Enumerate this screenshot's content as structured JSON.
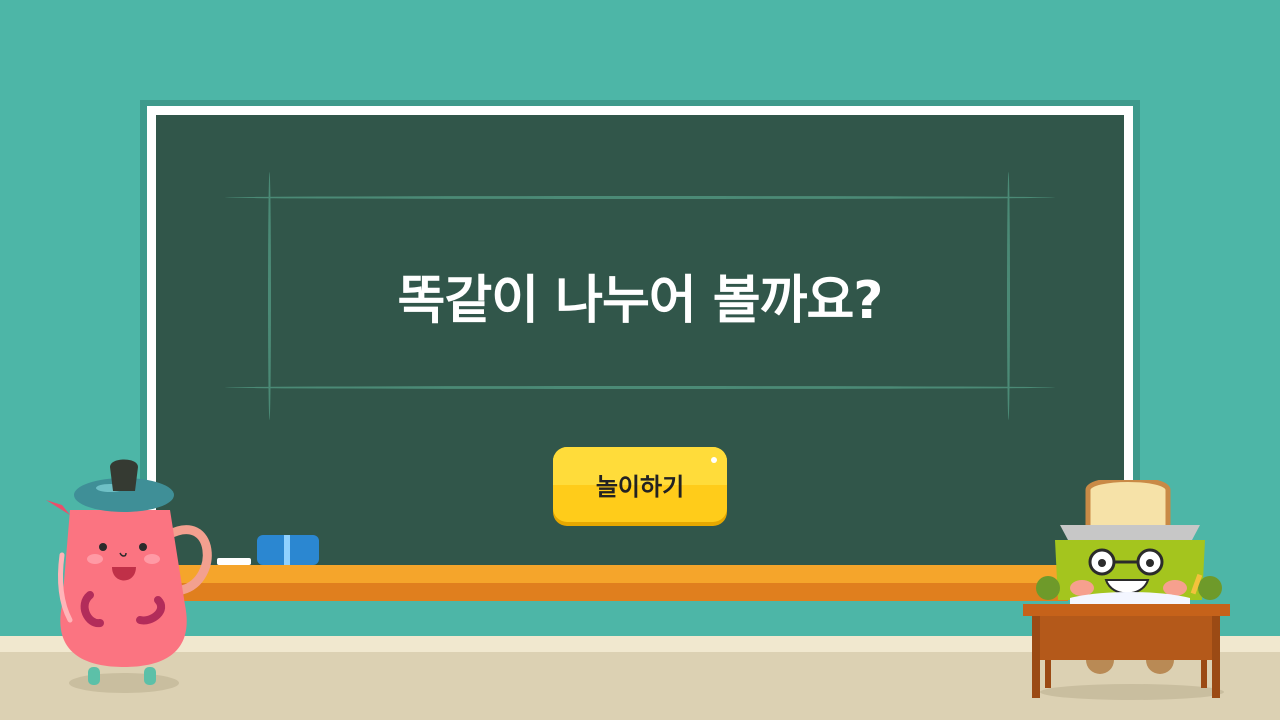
{
  "scene": {
    "title": "똑같이 나누어 볼까요?",
    "play_button_label": "놀이하기"
  },
  "colors": {
    "wall": "#4db6a7",
    "chalkboard": "#31564a",
    "board_frame": "#ffffff",
    "ledge": "#f5a52b",
    "button": "#ffcc1a",
    "floor": "#dcd1b3"
  },
  "characters": [
    "pitcher-character",
    "toaster-character"
  ],
  "props": [
    "chalk",
    "eraser",
    "school-desk"
  ]
}
